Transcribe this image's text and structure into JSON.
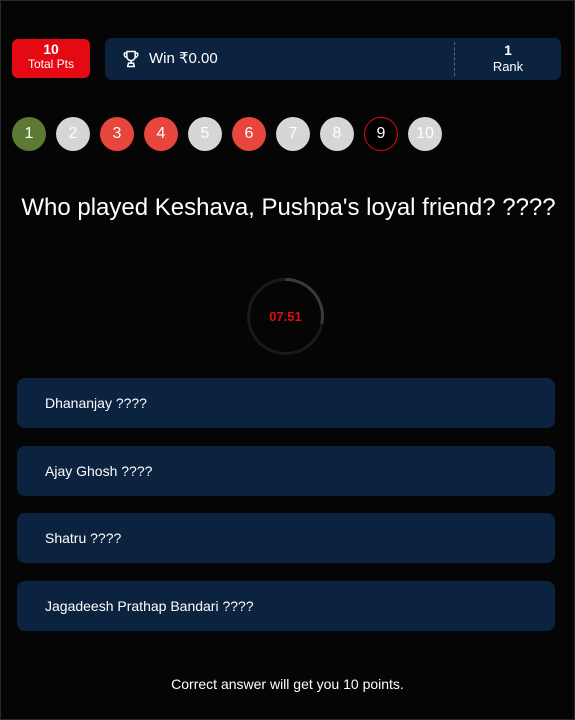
{
  "header": {
    "points_value": "10",
    "points_label": "Total Pts",
    "win_label": "Win ₹0.00",
    "rank_value": "1",
    "rank_label": "Rank"
  },
  "questions": [
    {
      "label": "1",
      "status": "correct"
    },
    {
      "label": "2",
      "status": "skipped"
    },
    {
      "label": "3",
      "status": "wrong"
    },
    {
      "label": "4",
      "status": "wrong"
    },
    {
      "label": "5",
      "status": "skipped"
    },
    {
      "label": "6",
      "status": "wrong"
    },
    {
      "label": "7",
      "status": "skipped"
    },
    {
      "label": "8",
      "status": "skipped"
    },
    {
      "label": "9",
      "status": "current"
    },
    {
      "label": "10",
      "status": "skipped"
    }
  ],
  "question": {
    "text": "Who played Keshava, Pushpa's loyal friend? ????"
  },
  "timer": {
    "display": "07.51",
    "remaining_fraction": 0.28
  },
  "options": [
    {
      "label": "Dhananjay ????"
    },
    {
      "label": "Ajay Ghosh ????"
    },
    {
      "label": "Shatru ????"
    },
    {
      "label": "Jagadeesh Prathap Bandari ????"
    }
  ],
  "footer": {
    "note": "Correct answer will get you 10 points."
  },
  "colors": {
    "accent": "#e50914",
    "panel": "#0c2340",
    "correct": "#5c7a35",
    "wrong": "#e8453c",
    "skipped": "#d6d6d6"
  },
  "icons": {
    "win": "trophy-icon"
  }
}
